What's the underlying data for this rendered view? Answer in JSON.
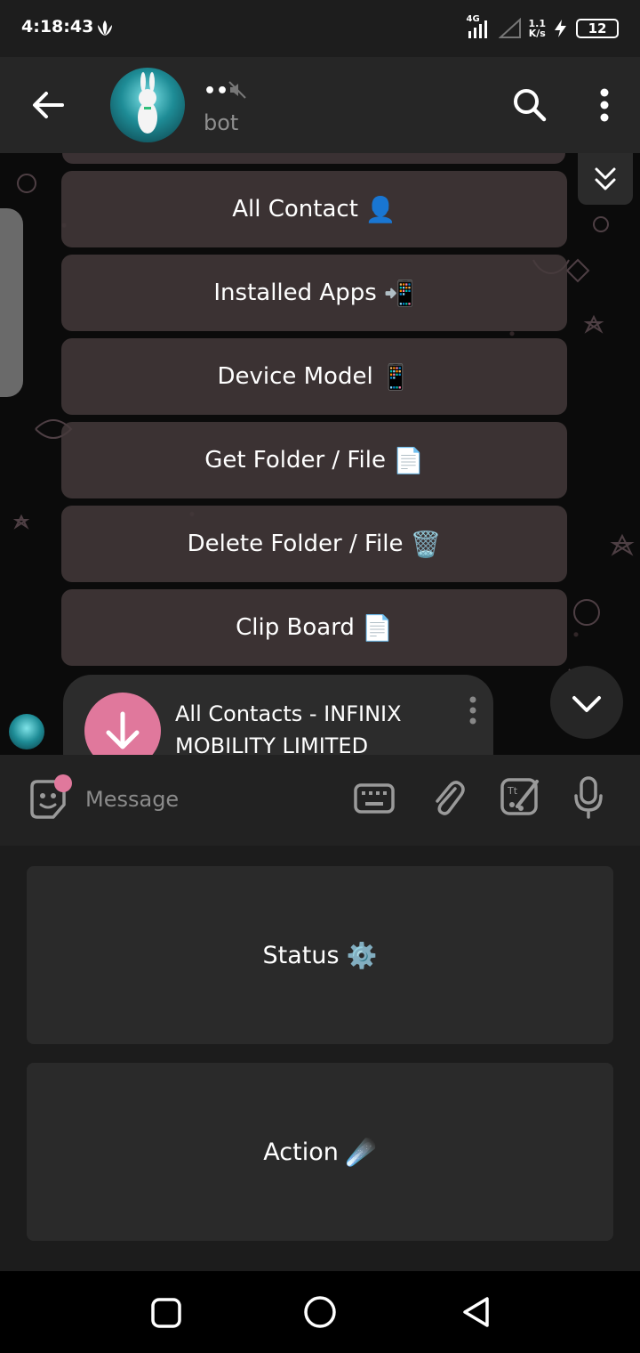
{
  "status_bar": {
    "time": "4:18:43",
    "network_type": "4G",
    "net_speed_value": "1.1",
    "net_speed_unit": "K/s",
    "battery": "12"
  },
  "header": {
    "chat_name": "••",
    "chat_status": "bot"
  },
  "keyboard_buttons": [
    {
      "label": "All Contact",
      "emoji": "👤"
    },
    {
      "label": "Installed Apps",
      "emoji": "📲"
    },
    {
      "label": "Device Model",
      "emoji": "📱"
    },
    {
      "label": "Get Folder / File",
      "emoji": "📄"
    },
    {
      "label": "Delete Folder / File",
      "emoji": "🗑️"
    },
    {
      "label": "Clip Board",
      "emoji": "📄"
    }
  ],
  "message": {
    "file_name": "All Contacts - INFINIX MOBILITY LIMITED Infinix…"
  },
  "input": {
    "placeholder": "Message"
  },
  "reply_keyboard": [
    {
      "label": "Status",
      "emoji": "⚙️"
    },
    {
      "label": "Action",
      "emoji": "☄️"
    }
  ],
  "colors": {
    "accent_pink": "#e0789c",
    "keyboard_button_bg": "#463a3c",
    "app_bar_bg": "#262626"
  }
}
